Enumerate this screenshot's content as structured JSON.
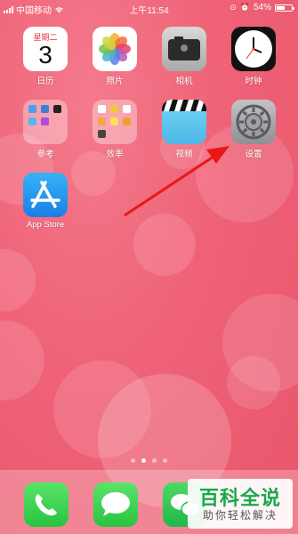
{
  "status": {
    "carrier": "中国移动",
    "time": "上午11:54",
    "battery_percent": "54%",
    "battery_level": 0.54
  },
  "apps": {
    "calendar": {
      "label": "日历",
      "weekday": "星期二",
      "day": "3"
    },
    "photos": {
      "label": "照片"
    },
    "camera": {
      "label": "相机"
    },
    "clock": {
      "label": "时钟"
    },
    "folder_reference": {
      "label": "参考"
    },
    "folder_efficiency": {
      "label": "效率"
    },
    "videos": {
      "label": "视频"
    },
    "settings": {
      "label": "设置"
    },
    "app_store": {
      "label": "App Store"
    }
  },
  "page_dots": {
    "count": 4,
    "active_index": 1
  },
  "dock": {
    "apps": [
      "phone-icon",
      "messages-icon",
      "wechat-icon"
    ]
  },
  "watermark": {
    "title": "百科全说",
    "subtitle": "助你轻松解决"
  },
  "colors": {
    "wallpaper": "#f0657a",
    "annotation_arrow": "#e81818",
    "watermark_green": "#1aa84a"
  }
}
